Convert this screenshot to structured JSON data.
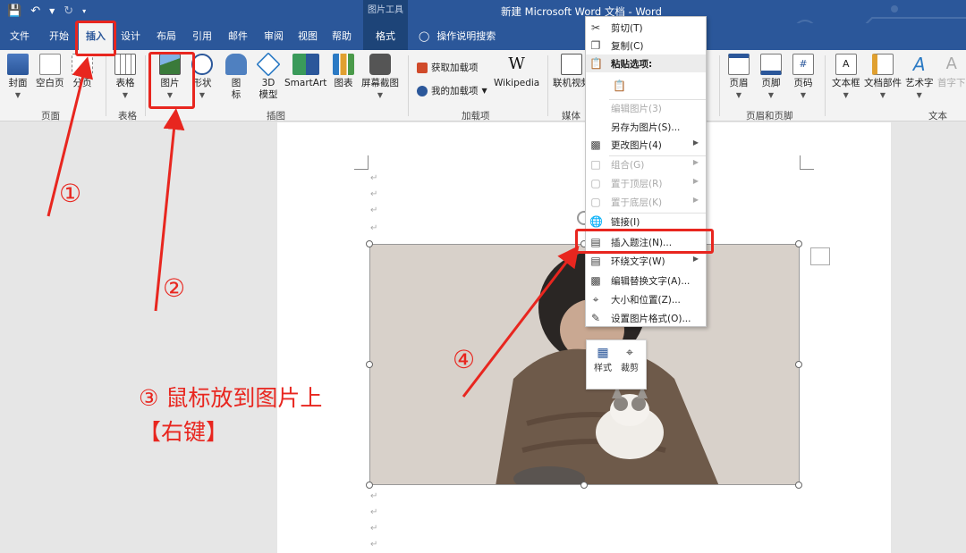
{
  "titlebar": {
    "context_tools": "图片工具",
    "doc_title": "新建 Microsoft Word 文档 - Word",
    "qat": [
      "save-icon",
      "undo-icon",
      "redo-icon",
      "customize-icon"
    ]
  },
  "tabs": {
    "file": "文件",
    "home": "开始",
    "insert": "插入",
    "design": "设计",
    "layout": "布局",
    "references": "引用",
    "mailings": "邮件",
    "review": "审阅",
    "view": "视图",
    "help": "帮助",
    "format": "格式",
    "tell_me": "操作说明搜索"
  },
  "ribbon": {
    "cover": "封面",
    "blank_page": "空白页",
    "page_break": "分页",
    "table": "表格",
    "picture": "图片",
    "shapes": "形状",
    "icons_line1": "图",
    "icons_line2": "标",
    "model_line1": "3D",
    "model_line2": "模型",
    "smartart": "SmartArt",
    "chart": "图表",
    "screenshot": "屏幕截图",
    "get_addins": "获取加载项",
    "my_addins": "我的加载项",
    "wikipedia": "Wikipedia",
    "online_video": "联机视频",
    "header": "页眉",
    "footer": "页脚",
    "page_number": "页码",
    "textbox": "文本框",
    "quick_parts": "文档部件",
    "wordart": "艺术字",
    "dropcap": "首字下",
    "groups": {
      "pages": "页面",
      "tables": "表格",
      "illustrations": "插图",
      "addins": "加载项",
      "media": "媒体",
      "header_footer": "页眉和页脚",
      "text": "文本"
    }
  },
  "context_menu": {
    "cut": "剪切(T)",
    "copy": "复制(C)",
    "paste_options": "粘贴选项:",
    "edit_picture": "编辑图片(3)",
    "save_as_picture": "另存为图片(S)...",
    "change_picture": "更改图片(4)",
    "group": "组合(G)",
    "bring_to_front": "置于顶层(R)",
    "send_to_back": "置于底层(K)",
    "link": "链接(I)",
    "insert_caption": "插入题注(N)...",
    "wrap_text": "环绕文字(W)",
    "edit_alt_text": "编辑替换文字(A)...",
    "size_position": "大小和位置(Z)...",
    "format_picture": "设置图片格式(O)..."
  },
  "mini_toolbar": {
    "style": "样式",
    "crop": "裁剪"
  },
  "annotations": {
    "step1": "①",
    "step2": "②",
    "step3_line1": "③ 鼠标放到图片上",
    "step3_line2": "【右键】",
    "step4": "④",
    "color": "#e8261f"
  },
  "colors": {
    "ribbon_blue": "#2b579a",
    "accent_red": "#e8261f"
  }
}
